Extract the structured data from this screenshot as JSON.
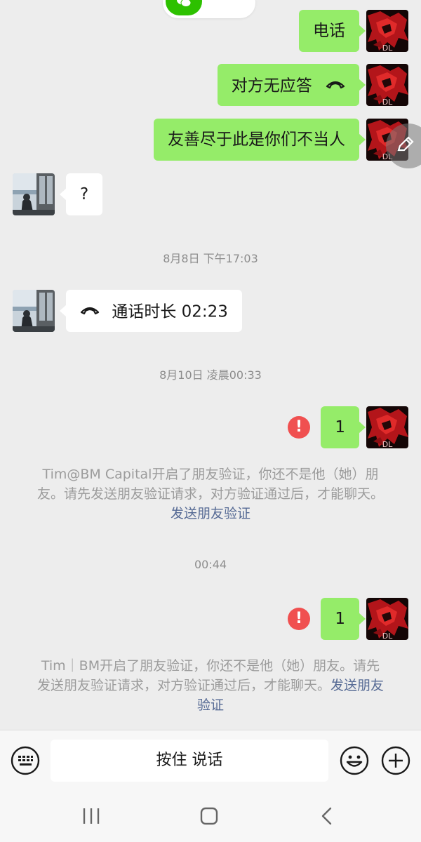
{
  "messages": {
    "m1_text": "电话",
    "m2_text": "对方无应答",
    "m3_text": "友善尽于此是你们不当人",
    "m4_text": "?",
    "ts1": "8月8日 下午17:03",
    "m5_text": "通话时长 02:23",
    "ts2": "8月10日 凌晨00:33",
    "m6_text": "1",
    "sys1_text": "Tim@BM Capital开启了朋友验证，你还不是他（她）朋友。请先发送朋友验证请求，对方验证通过后，才能聊天。",
    "sys1_link": "发送朋友验证",
    "ts3": "00:44",
    "m7_text": "1",
    "sys2_text": "Tim｜BM开启了朋友验证，你还不是他（她）朋友。请先发送朋友验证请求，对方验证通过后，才能聊天。",
    "sys2_link": "发送朋友验证",
    "error_mark": "!"
  },
  "input": {
    "hold_to_talk": "按住 说话"
  },
  "colors": {
    "outgoing_bubble": "#95ec69",
    "incoming_bubble": "#ffffff",
    "background": "#ededed",
    "link": "#576b95",
    "error": "#f05050"
  },
  "icons": [
    "phone-hangup-icon",
    "keyboard-icon",
    "emoji-icon",
    "plus-icon",
    "edit-icon",
    "recent-apps-icon",
    "home-icon",
    "back-icon"
  ]
}
